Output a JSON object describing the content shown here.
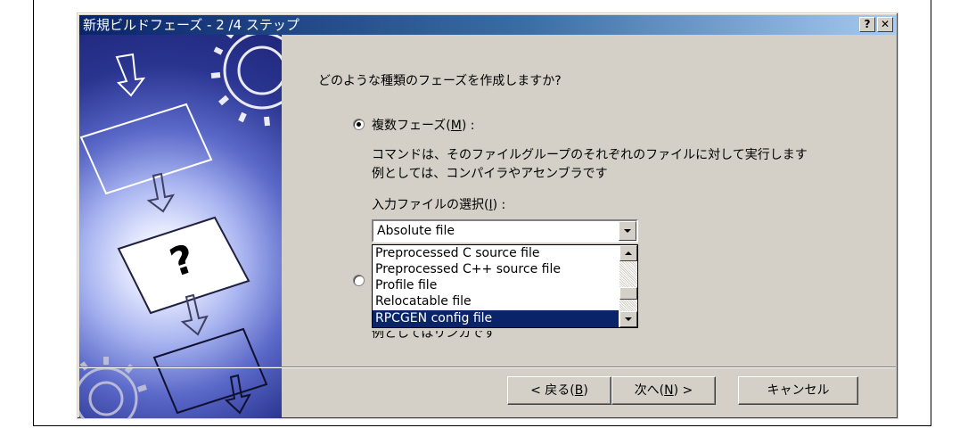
{
  "window": {
    "title": "新規ビルドフェーズ - 2 /4 ステップ",
    "help_label": "?",
    "close_label": "✕"
  },
  "main": {
    "question": "どのような種類のフェーズを作成しますか?",
    "option_multiple": {
      "label": "複数フェーズ(M) :",
      "label_prefix": "複数フェーズ(",
      "label_key": "M",
      "label_suffix": ") :",
      "selected": true,
      "desc_line1": "コマンドは、そのファイルグループのそれぞれのファイルに対して実行します",
      "desc_line2": "例としては、コンパイラやアセンブラです"
    },
    "input_select_label": "入力ファイルの選択(I) :",
    "input_select_prefix": "入力ファイルの選択(",
    "input_select_key": "I",
    "input_select_suffix": ") :",
    "combo_value": "Absolute file",
    "dropdown_items": [
      "Preprocessed C source file",
      "Preprocessed C++ source file",
      "Profile file",
      "Relocatable file",
      "RPCGEN config file"
    ],
    "dropdown_selected_index": 4,
    "option_single": {
      "selected": false,
      "obscured_text": "例としてはリンカです"
    }
  },
  "footer": {
    "back_label": "< 戻る(B)",
    "back_prefix": "< 戻る(",
    "back_key": "B",
    "back_suffix": ")",
    "next_label": "次へ(N) >",
    "next_prefix": "次へ(",
    "next_key": "N",
    "next_suffix": ") >",
    "cancel_label": "キャンセル"
  },
  "colors": {
    "title_active": "#0a246a",
    "face": "#d4d0c8",
    "highlight": "#0a246a"
  }
}
